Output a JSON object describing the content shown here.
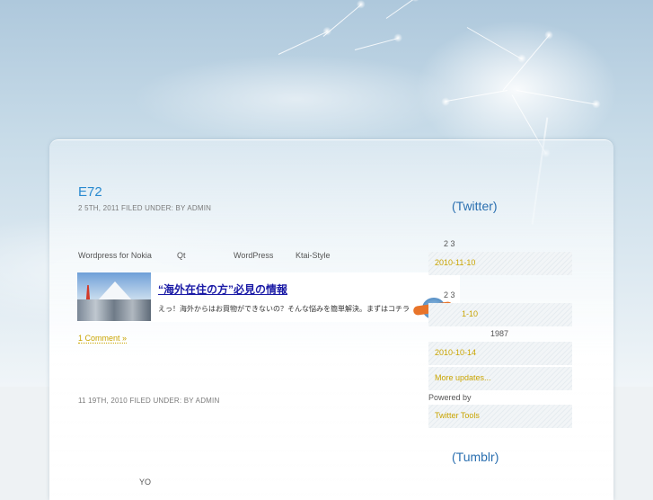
{
  "post1": {
    "title": "E72",
    "meta_date": "2  5TH, 2011 FILED UNDER:",
    "meta_cat": "  ",
    "meta_by": "BY ADMIN",
    "tags": [
      "Wordpress for Nokia",
      "Qt",
      "WordPress",
      "Ktai-Style"
    ],
    "banner_link": "“海外在住の方”必見の情報",
    "banner_text": "えっ！海外からはお買物ができないの？そんな悩みを簡単解決。まずはコチラ",
    "comments": "1 Comment »"
  },
  "post2": {
    "meta_date": "11  19TH, 2010 FILED UNDER:",
    "meta_cat": "  ",
    "meta_by": "BY ADMIN",
    "body_start": "YO"
  },
  "sidebar": {
    "twitter_title": "(Twitter)",
    "tweets": [
      {
        "text": "2 3",
        "date": "2010-11-10"
      },
      {
        "text": "2 3",
        "date": "1-10"
      },
      {
        "text": "1987",
        "date": "2010-10-14"
      }
    ],
    "more": "More updates...",
    "powered_by": "Powered by",
    "twitter_tools": "Twitter Tools",
    "tumblr_title": "(Tumblr)"
  },
  "colors": {
    "accent_link": "#2a8ad0",
    "gold": "#c9a400",
    "sidebar_title": "#2a6fb0"
  }
}
